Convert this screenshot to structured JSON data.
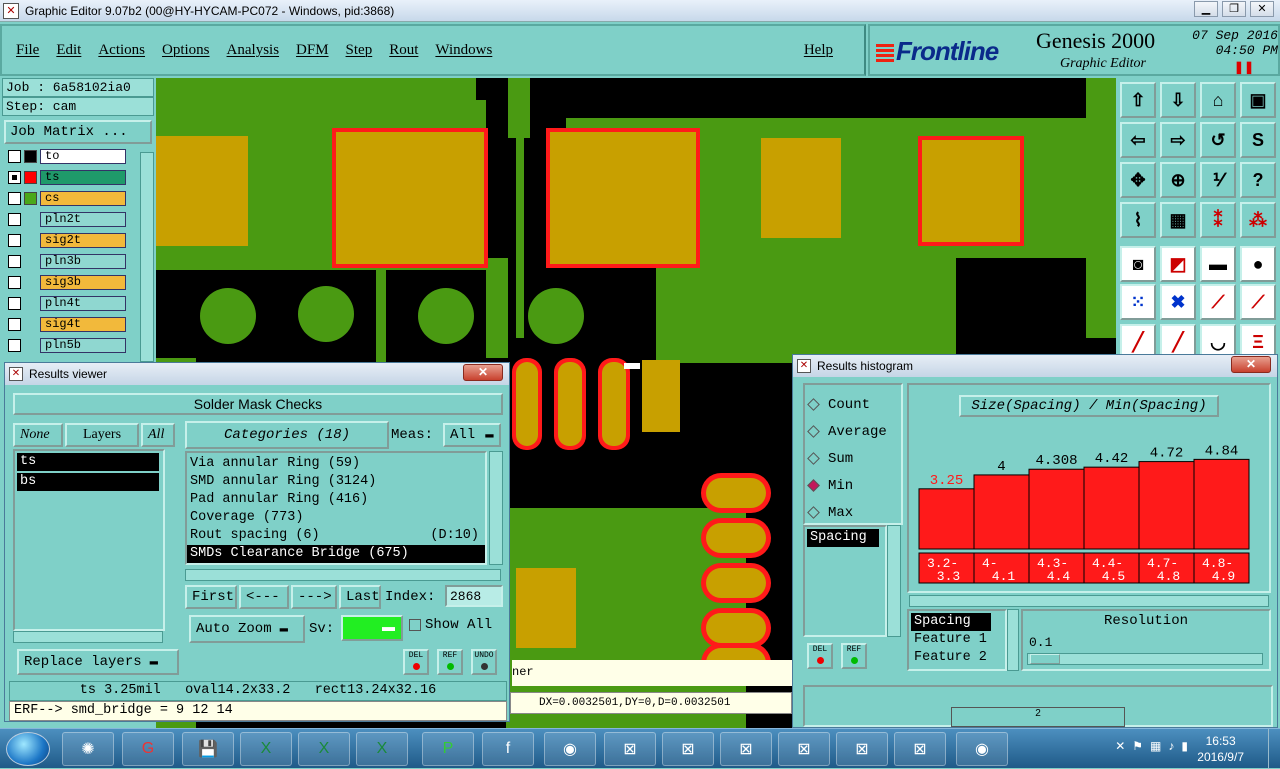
{
  "window": {
    "title": "Graphic Editor 9.07b2 (00@HY-HYCAM-PC072 - Windows, pid:3868)"
  },
  "menu": {
    "items": [
      "File",
      "Edit",
      "Actions",
      "Options",
      "Analysis",
      "DFM",
      "Step",
      "Rout",
      "Windows"
    ],
    "help": "Help"
  },
  "brand": {
    "logo": "Frontline",
    "product": "Genesis 2000",
    "subtitle": "Graphic Editor",
    "date": "07 Sep 2016",
    "time": "04:50 PM"
  },
  "job": {
    "job_line": "Job : 6a58102ia0",
    "step_line": "Step: cam",
    "matrix_button": "Job Matrix ..."
  },
  "layers": [
    {
      "name": "to",
      "color": "#ffffff",
      "swatch": "#000000"
    },
    {
      "name": "ts",
      "color": "#1f9a6a",
      "swatch": "#ff0000",
      "active": true
    },
    {
      "name": "cs",
      "color": "#f2b93b",
      "swatch": "#4aa81a"
    },
    {
      "name": "pln2t",
      "color": "#8fd7d0",
      "swatch": ""
    },
    {
      "name": "sig2t",
      "color": "#f2b93b",
      "swatch": ""
    },
    {
      "name": "pln3b",
      "color": "#8fd7d0",
      "swatch": ""
    },
    {
      "name": "sig3b",
      "color": "#f2b93b",
      "swatch": ""
    },
    {
      "name": "pln4t",
      "color": "#8fd7d0",
      "swatch": ""
    },
    {
      "name": "sig4t",
      "color": "#f2b93b",
      "swatch": ""
    },
    {
      "name": "pln5b",
      "color": "#8fd7d0",
      "swatch": ""
    }
  ],
  "results_viewer": {
    "title": "Results viewer",
    "header": "Solder Mask Checks",
    "none": "None",
    "layers_label": "Layers",
    "all": "All",
    "layer_list": [
      "ts",
      "bs"
    ],
    "categories_button": "Categories (18)",
    "meas_label": "Meas:",
    "meas_value": "All",
    "categories": [
      {
        "text": "Via annular Ring (59)"
      },
      {
        "text": "SMD annular Ring (3124)"
      },
      {
        "text": "Pad annular Ring (416)"
      },
      {
        "text": "Coverage (773)"
      },
      {
        "text": "Rout spacing (6)",
        "extra": "(D:10)"
      },
      {
        "text": "SMDs Clearance Bridge (675)",
        "selected": true
      }
    ],
    "nav": {
      "first": "First",
      "prev": "<---",
      "next": "--->",
      "last": "Last",
      "index_label": "Index:",
      "index_value": "2868"
    },
    "auto_zoom": "Auto Zoom",
    "sv_label": "Sv:",
    "show_all": "Show All",
    "replace_layers": "Replace layers",
    "btn_del": "DEL",
    "btn_ref": "REF",
    "btn_undo": "UNDO",
    "info_line": "ts 3.25mil   oval14.2x33.2   rect13.24x32.16",
    "erf_line": "ERF--> smd_bridge = 9 12 14"
  },
  "histogram": {
    "title": "Results histogram",
    "modes": [
      {
        "label": "Count",
        "selected": false
      },
      {
        "label": "Average",
        "selected": false
      },
      {
        "label": "Sum",
        "selected": false
      },
      {
        "label": "Min",
        "selected": true
      },
      {
        "label": "Max",
        "selected": false
      }
    ],
    "list_item": "Spacing",
    "chart_title": "Size(Spacing) / Min(Spacing)",
    "feature_list": [
      "Spacing",
      "Feature 1",
      "Feature 2"
    ],
    "resolution_label": "Resolution",
    "resolution_value": "0.1",
    "btn_del": "DEL",
    "btn_ref": "REF"
  },
  "chart_data": {
    "type": "bar",
    "title": "Size(Spacing) / Min(Spacing)",
    "categories": [
      "3.2-3.3",
      "4-4.1",
      "4.3-4.4",
      "4.4-4.5",
      "4.7-4.8",
      "4.8-4.9"
    ],
    "category_lines": [
      [
        "3.2-",
        "3.3"
      ],
      [
        "4-",
        "4.1"
      ],
      [
        "4.3-",
        "4.4"
      ],
      [
        "4.4-",
        "4.5"
      ],
      [
        "4.7-",
        "4.8"
      ],
      [
        "4.8-",
        "4.9"
      ]
    ],
    "values": [
      3.25,
      4,
      4.308,
      4.42,
      4.72,
      4.84
    ],
    "value_labels": [
      "3.25",
      "4",
      "4.308",
      "4.42",
      "4.72",
      "4.84"
    ],
    "ylim": [
      0,
      5.4
    ],
    "bar_color": "#ff1a1a",
    "first_label_color": "#ff1a1a"
  },
  "status": {
    "measure": "DX=0.0032501,DY=0,D=0.0032501",
    "corner": "ner",
    "canvas_label": "2"
  },
  "taskbar": {
    "time": "16:53",
    "date": "2016/9/7"
  },
  "colors": {
    "background": "#7fd0c8",
    "board_copper": "#4a9a12",
    "pad": "#c8a000",
    "mask_outline": "#ff0000"
  }
}
